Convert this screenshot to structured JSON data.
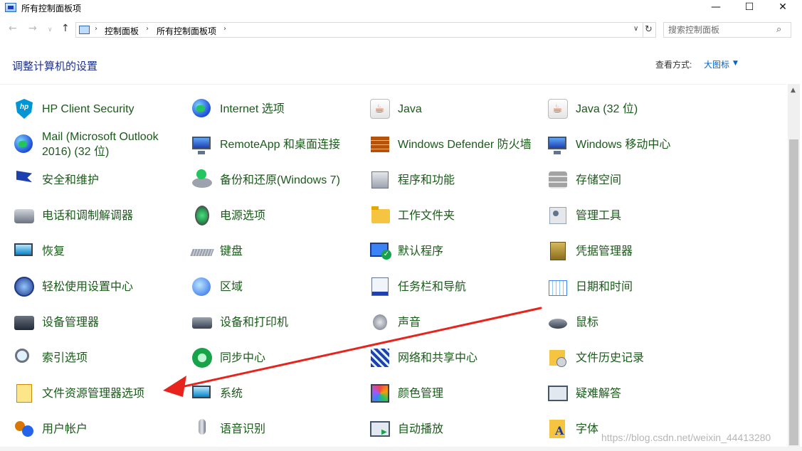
{
  "window": {
    "title": "所有控制面板项",
    "minimize": "—",
    "maximize": "☐",
    "close": "✕"
  },
  "nav": {
    "back": "←",
    "forward": "→",
    "dropdown": "∨",
    "up": "↑",
    "breadcrumb": [
      "控制面板",
      "所有控制面板项"
    ],
    "separator": "›",
    "address_dropdown": "∨",
    "refresh": "↻"
  },
  "search": {
    "placeholder": "搜索控制面板",
    "icon": "search-icon"
  },
  "header": {
    "title": "调整计算机的设置",
    "view_label": "查看方式:",
    "view_value": "大图标",
    "view_caret": "▼"
  },
  "items": [
    {
      "label": "HP Client Security",
      "icon": "hp-shield-icon"
    },
    {
      "label": "Internet 选项",
      "icon": "internet-options-icon"
    },
    {
      "label": "Java",
      "icon": "java-icon"
    },
    {
      "label": "Java (32 位)",
      "icon": "java-icon"
    },
    {
      "label": "Mail (Microsoft Outlook 2016) (32 位)",
      "icon": "mail-icon"
    },
    {
      "label": "RemoteApp 和桌面连接",
      "icon": "remoteapp-icon"
    },
    {
      "label": "Windows Defender 防火墙",
      "icon": "firewall-icon"
    },
    {
      "label": "Windows 移动中心",
      "icon": "mobility-center-icon"
    },
    {
      "label": "安全和维护",
      "icon": "flag-icon"
    },
    {
      "label": "备份和还原(Windows 7)",
      "icon": "backup-icon"
    },
    {
      "label": "程序和功能",
      "icon": "programs-icon"
    },
    {
      "label": "存储空间",
      "icon": "storage-icon"
    },
    {
      "label": "电话和调制解调器",
      "icon": "phone-icon"
    },
    {
      "label": "电源选项",
      "icon": "power-icon"
    },
    {
      "label": "工作文件夹",
      "icon": "folder-icon"
    },
    {
      "label": "管理工具",
      "icon": "admin-tools-icon"
    },
    {
      "label": "恢复",
      "icon": "recovery-icon"
    },
    {
      "label": "键盘",
      "icon": "keyboard-icon"
    },
    {
      "label": "默认程序",
      "icon": "default-programs-icon"
    },
    {
      "label": "凭据管理器",
      "icon": "credential-safe-icon"
    },
    {
      "label": "轻松使用设置中心",
      "icon": "ease-of-access-icon"
    },
    {
      "label": "区域",
      "icon": "region-icon"
    },
    {
      "label": "任务栏和导航",
      "icon": "taskbar-icon"
    },
    {
      "label": "日期和时间",
      "icon": "calendar-icon"
    },
    {
      "label": "设备管理器",
      "icon": "device-manager-icon"
    },
    {
      "label": "设备和打印机",
      "icon": "printer-icon"
    },
    {
      "label": "声音",
      "icon": "speaker-icon"
    },
    {
      "label": "鼠标",
      "icon": "mouse-icon"
    },
    {
      "label": "索引选项",
      "icon": "indexing-icon"
    },
    {
      "label": "同步中心",
      "icon": "sync-icon"
    },
    {
      "label": "网络和共享中心",
      "icon": "network-icon"
    },
    {
      "label": "文件历史记录",
      "icon": "file-history-icon"
    },
    {
      "label": "文件资源管理器选项",
      "icon": "folder-options-icon"
    },
    {
      "label": "系统",
      "icon": "system-icon"
    },
    {
      "label": "颜色管理",
      "icon": "color-management-icon"
    },
    {
      "label": "疑难解答",
      "icon": "troubleshooting-icon"
    },
    {
      "label": "用户帐户",
      "icon": "users-icon"
    },
    {
      "label": "语音识别",
      "icon": "microphone-icon"
    },
    {
      "label": "自动播放",
      "icon": "autoplay-icon"
    },
    {
      "label": "字体",
      "icon": "fonts-icon"
    }
  ],
  "scrollbar": {
    "up": "▲"
  },
  "watermark": "https://blog.csdn.net/weixin_44413280",
  "colors": {
    "title_blue": "#1e3287",
    "item_green": "#1a5a1a",
    "link_blue": "#0066cc",
    "arrow_red": "#e8231b"
  }
}
